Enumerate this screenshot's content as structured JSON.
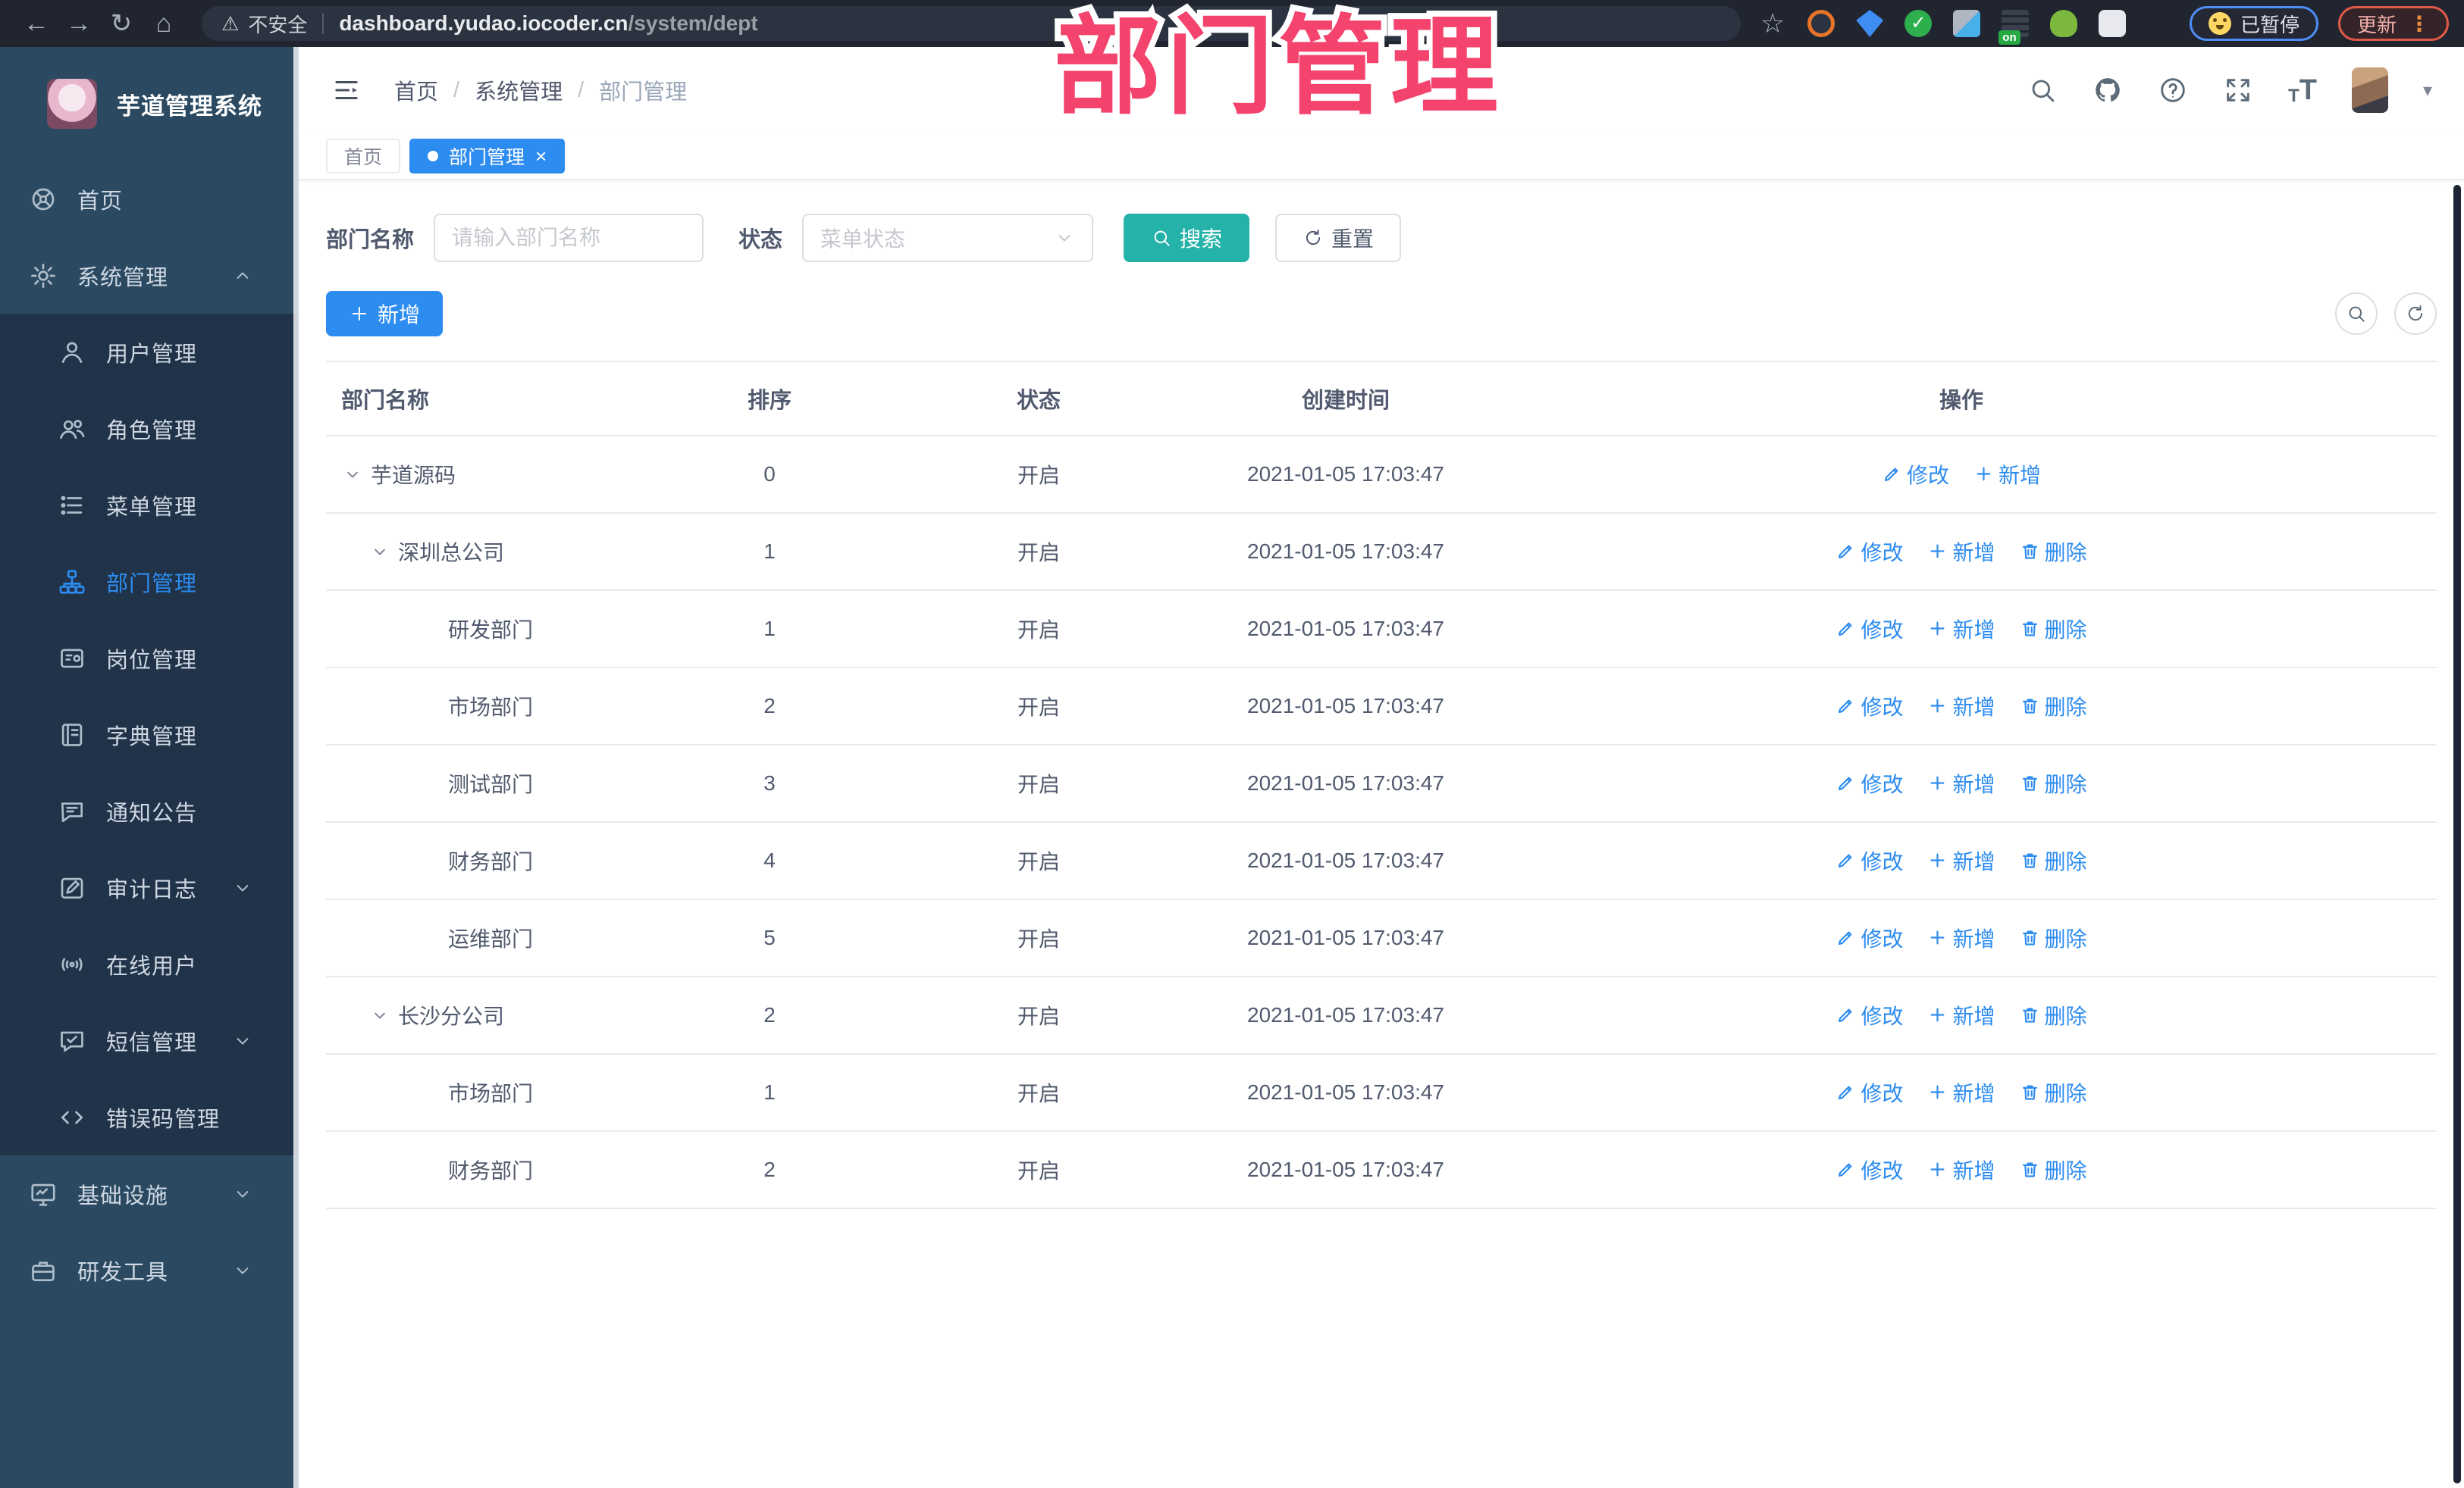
{
  "browser": {
    "security_label": "不安全",
    "url_host": "dashboard.yudao.iocoder.cn",
    "url_path": "/system/dept",
    "paused_label": "已暂停",
    "update_label": "更新",
    "icons": {
      "back": "←",
      "forward": "→",
      "reload": "↻",
      "home": "⌂",
      "warning": "⚠",
      "star": "☆",
      "menu_dots": "⋮",
      "caret_down": "▾"
    }
  },
  "overlay": {
    "title": "部门管理"
  },
  "sidebar": {
    "app_title": "芋道管理系统",
    "items": [
      {
        "key": "home",
        "label": "首页",
        "icon": "dashboard-icon"
      },
      {
        "key": "system-admin",
        "label": "系统管理",
        "icon": "gear-icon",
        "arrow": "up",
        "children": [
          {
            "key": "user-mgmt",
            "label": "用户管理",
            "icon": "user-icon"
          },
          {
            "key": "role-mgmt",
            "label": "角色管理",
            "icon": "users-icon"
          },
          {
            "key": "menu-mgmt",
            "label": "菜单管理",
            "icon": "menu-list-icon"
          },
          {
            "key": "dept-mgmt",
            "label": "部门管理",
            "icon": "org-tree-icon",
            "active": true
          },
          {
            "key": "post-mgmt",
            "label": "岗位管理",
            "icon": "badge-icon"
          },
          {
            "key": "dict-mgmt",
            "label": "字典管理",
            "icon": "dict-icon"
          },
          {
            "key": "notice",
            "label": "通知公告",
            "icon": "notice-icon"
          },
          {
            "key": "audit-log",
            "label": "审计日志",
            "icon": "audit-icon",
            "arrow": "down"
          },
          {
            "key": "online-users",
            "label": "在线用户",
            "icon": "online-icon"
          },
          {
            "key": "sms-mgmt",
            "label": "短信管理",
            "icon": "sms-icon",
            "arrow": "down"
          },
          {
            "key": "error-code-mgmt",
            "label": "错误码管理",
            "icon": "code-icon"
          }
        ]
      },
      {
        "key": "infrastructure",
        "label": "基础设施",
        "icon": "monitor-icon",
        "arrow": "down"
      },
      {
        "key": "dev-tools",
        "label": "研发工具",
        "icon": "toolbox-icon",
        "arrow": "down"
      }
    ]
  },
  "header": {
    "breadcrumb": [
      "首页",
      "系统管理",
      "部门管理"
    ]
  },
  "tabs": [
    {
      "label": "首页",
      "active": false
    },
    {
      "label": "部门管理",
      "active": true,
      "close": "×"
    }
  ],
  "filter": {
    "name_label": "部门名称",
    "name_placeholder": "请输入部门名称",
    "status_label": "状态",
    "status_placeholder": "菜单状态",
    "search_label": "搜索",
    "reset_label": "重置"
  },
  "toolbar": {
    "add_label": "新增"
  },
  "table": {
    "columns": [
      "部门名称",
      "排序",
      "状态",
      "创建时间",
      "操作"
    ],
    "action_labels": {
      "edit": "修改",
      "add": "新增",
      "delete": "删除"
    },
    "rows": [
      {
        "name": "芋道源码",
        "level": 0,
        "expandable": true,
        "sort": "0",
        "status": "开启",
        "created": "2021-01-05 17:03:47",
        "actions": [
          "edit",
          "add"
        ]
      },
      {
        "name": "深圳总公司",
        "level": 1,
        "expandable": true,
        "sort": "1",
        "status": "开启",
        "created": "2021-01-05 17:03:47",
        "actions": [
          "edit",
          "add",
          "delete"
        ]
      },
      {
        "name": "研发部门",
        "level": 2,
        "expandable": false,
        "sort": "1",
        "status": "开启",
        "created": "2021-01-05 17:03:47",
        "actions": [
          "edit",
          "add",
          "delete"
        ]
      },
      {
        "name": "市场部门",
        "level": 2,
        "expandable": false,
        "sort": "2",
        "status": "开启",
        "created": "2021-01-05 17:03:47",
        "actions": [
          "edit",
          "add",
          "delete"
        ]
      },
      {
        "name": "测试部门",
        "level": 2,
        "expandable": false,
        "sort": "3",
        "status": "开启",
        "created": "2021-01-05 17:03:47",
        "actions": [
          "edit",
          "add",
          "delete"
        ]
      },
      {
        "name": "财务部门",
        "level": 2,
        "expandable": false,
        "sort": "4",
        "status": "开启",
        "created": "2021-01-05 17:03:47",
        "actions": [
          "edit",
          "add",
          "delete"
        ]
      },
      {
        "name": "运维部门",
        "level": 2,
        "expandable": false,
        "sort": "5",
        "status": "开启",
        "created": "2021-01-05 17:03:47",
        "actions": [
          "edit",
          "add",
          "delete"
        ]
      },
      {
        "name": "长沙分公司",
        "level": 1,
        "expandable": true,
        "sort": "2",
        "status": "开启",
        "created": "2021-01-05 17:03:47",
        "actions": [
          "edit",
          "add",
          "delete"
        ]
      },
      {
        "name": "市场部门",
        "level": 2,
        "expandable": false,
        "sort": "1",
        "status": "开启",
        "created": "2021-01-05 17:03:47",
        "actions": [
          "edit",
          "add",
          "delete"
        ]
      },
      {
        "name": "财务部门",
        "level": 2,
        "expandable": false,
        "sort": "2",
        "status": "开启",
        "created": "2021-01-05 17:03:47",
        "actions": [
          "edit",
          "add",
          "delete"
        ]
      }
    ]
  },
  "colors": {
    "accent_blue": "#2d8cf0",
    "search_teal": "#25b2a8",
    "overlay_pink": "#f4436d",
    "sidebar_bg": "#2b4a62",
    "submenu_bg": "#203349",
    "chrome_bg": "#20252f",
    "table_border": "#e8eaec",
    "text_main": "#515a6e"
  }
}
